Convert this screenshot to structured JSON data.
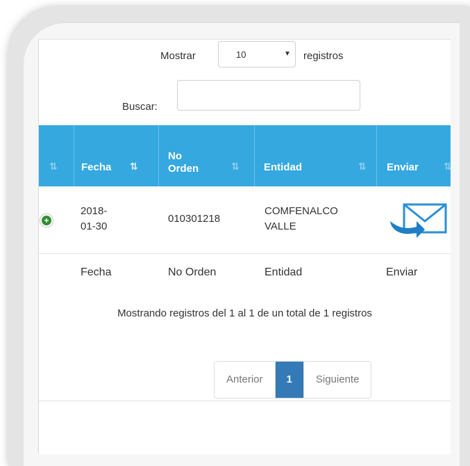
{
  "length": {
    "prefix": "Mostrar",
    "value": "10",
    "suffix": "registros",
    "caret": "▼"
  },
  "search": {
    "label": "Buscar:",
    "value": ""
  },
  "table": {
    "header": {
      "col1": "Fecha",
      "col2": "No Orden",
      "col3": "Entidad",
      "col4": "Enviar",
      "sort_icon": "⇅",
      "sort_active_icon": "⇅"
    },
    "row": {
      "expand": "+",
      "fecha": "2018-01-30",
      "orden": "010301218",
      "entidad": "COMFENALCO VALLE",
      "enviar_icon": "envelope-icon"
    },
    "footer": {
      "col1": "Fecha",
      "col2": "No Orden",
      "col3": "Entidad",
      "col4": "Enviar"
    }
  },
  "info": "Mostrando registros del 1 al 1 de un total de 1 registros",
  "pagination": {
    "prev": "Anterior",
    "current": "1",
    "next": "Siguiente"
  },
  "colors": {
    "header_bg": "#35a8e0",
    "page_active": "#337ab7",
    "expand_green": "#2f8f2f",
    "envelope_blue": "#2a8fd6"
  }
}
